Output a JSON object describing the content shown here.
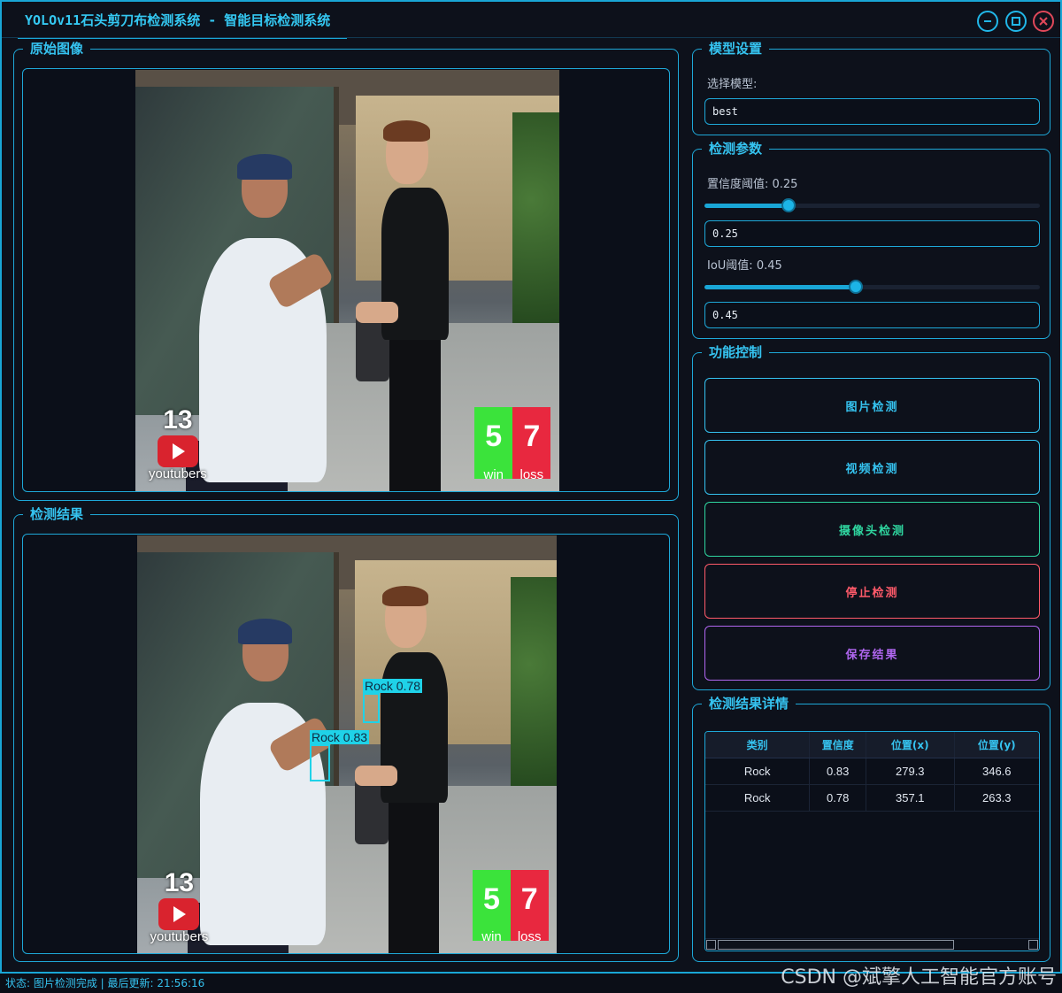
{
  "window": {
    "title": "YOLOv11石头剪刀布检测系统 - 智能目标检测系统",
    "controls": [
      "minimize-icon",
      "maximize-icon",
      "close-icon"
    ],
    "accent_color": "#19a6d6",
    "close_color": "#e0485a"
  },
  "original_panel": {
    "title": "原始图像",
    "overlay": {
      "count": "13",
      "brand": "youtubers",
      "win_value": "5",
      "win_label": "win",
      "loss_value": "7",
      "loss_label": "loss"
    }
  },
  "result_panel": {
    "title": "检测结果",
    "overlay": {
      "count": "13",
      "brand": "youtubers",
      "win_value": "5",
      "win_label": "win",
      "loss_value": "7",
      "loss_label": "loss"
    },
    "detections": [
      {
        "label": "Rock 0.78"
      },
      {
        "label": "Rock 0.83"
      }
    ]
  },
  "model_settings": {
    "title": "模型设置",
    "select_label": "选择模型:",
    "selected_model": "best"
  },
  "detect_params": {
    "title": "检测参数",
    "confidence": {
      "label": "置信度阈值: 0.25",
      "value": 0.25,
      "input_value": "0.25"
    },
    "iou": {
      "label": "IoU阈值: 0.45",
      "value": 0.45,
      "input_value": "0.45"
    }
  },
  "controls": {
    "title": "功能控制",
    "buttons": [
      {
        "label": "图片检测",
        "color": "#35c3f0"
      },
      {
        "label": "视频检测",
        "color": "#35c3f0"
      },
      {
        "label": "摄像头检测",
        "color": "#2fd6a0"
      },
      {
        "label": "停止检测",
        "color": "#ff5a6a"
      },
      {
        "label": "保存结果",
        "color": "#b066f0"
      }
    ]
  },
  "details": {
    "title": "检测结果详情",
    "columns": [
      "类别",
      "置信度",
      "位置(x)",
      "位置(y)"
    ],
    "rows": [
      [
        "Rock",
        "0.83",
        "279.3",
        "346.6"
      ],
      [
        "Rock",
        "0.78",
        "357.1",
        "263.3"
      ]
    ]
  },
  "status": {
    "text": "状态: 图片检测完成 | 最后更新: 21:56:16"
  },
  "watermark": "CSDN @斌擎人工智能官方账号"
}
